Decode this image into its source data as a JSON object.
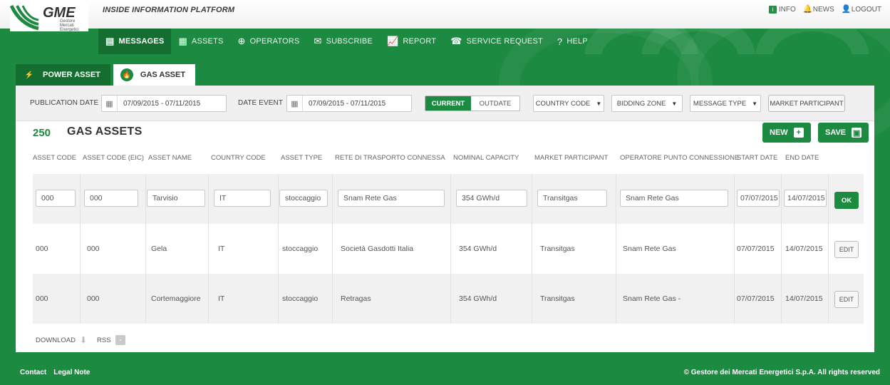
{
  "header": {
    "brand": "GME",
    "brand_sub": [
      "Gestore",
      "Mercati",
      "Energetici"
    ],
    "platform_title": "INSIDE INFORMATION PLATFORM",
    "top_links": [
      {
        "label": "INFO",
        "icon": "info-icon"
      },
      {
        "label": "NEWS",
        "icon": "bell-icon"
      },
      {
        "label": "LOGOUT",
        "icon": "user-icon"
      }
    ]
  },
  "nav": {
    "items": [
      {
        "label": "MESSAGES",
        "icon": "messages-icon",
        "active": true
      },
      {
        "label": "ASSETS",
        "icon": "factory-icon",
        "active": false
      },
      {
        "label": "OPERATORS",
        "icon": "operators-icon",
        "active": false
      },
      {
        "label": "SUBSCRIBE",
        "icon": "envelope-icon",
        "active": false
      },
      {
        "label": "REPORT",
        "icon": "chart-icon",
        "active": false
      },
      {
        "label": "SERVICE REQUEST",
        "icon": "support-icon",
        "active": false
      },
      {
        "label": "HELP",
        "icon": "help-icon",
        "active": false
      }
    ]
  },
  "tabs": [
    {
      "label": "POWER ASSET",
      "icon": "lightning-icon",
      "active": false
    },
    {
      "label": "GAS ASSET",
      "icon": "flame-icon",
      "active": true
    }
  ],
  "filters": {
    "publication_date_label": "PUBLICATION DATE",
    "publication_date_value": "07/09/2015 - 07/11/2015",
    "date_event_label": "DATE EVENT",
    "date_event_value": "07/09/2015 - 07/11/2015",
    "current_label": "CURRENT",
    "outdate_label": "OUTDATE",
    "country_code": "COUNTRY CODE",
    "bidding_zone": "BIDDING ZONE",
    "message_type": "MESSAGE TYPE",
    "market_participant": "MARKET PARTICIPANT"
  },
  "section": {
    "count": "250",
    "title": "GAS ASSETS",
    "new_label": "NEW",
    "save_label": "SAVE"
  },
  "table": {
    "columns": [
      "ASSET CODE",
      "ASSET CODE (EIC)",
      "ASSET NAME",
      "COUNTRY CODE",
      "ASSET TYPE",
      "RETE DI TRASPORTO CONNESSA",
      "NOMINAL CAPACITY",
      "MARKET PARTICIPANT",
      "OPERATORE PUNTO CONNESSIONE",
      "START DATE",
      "END DATE"
    ],
    "edit_row": [
      "000",
      "000",
      "Tarvisio",
      "IT",
      "stoccaggio",
      "Snam Rete Gas",
      "354 GWh/d",
      "Transitgas",
      "Snam Rete Gas",
      "07/07/2015",
      "14/07/2015"
    ],
    "ok_label": "OK",
    "edit_label": "EDIT",
    "rows": [
      [
        "000",
        "000",
        "Gela",
        "IT",
        "stoccaggio",
        "Società Gasdotti Italia",
        "354 GWh/d",
        "Transitgas",
        "Snam Rete Gas",
        "07/07/2015",
        "14/07/2015"
      ],
      [
        "000",
        "000",
        "Cortemaggiore",
        "IT",
        "stoccaggio",
        "Retragas",
        "354 GWh/d",
        "Transitgas",
        "Snam Rete Gas -",
        "07/07/2015",
        "14/07/2015"
      ]
    ]
  },
  "downloads": {
    "download_label": "DOWNLOAD",
    "rss_label": "RSS"
  },
  "footer": {
    "contact": "Contact",
    "legal": "Legal Note",
    "copyright": "© Gestore dei Mercati Energetici S.p.A.  All rights reserved"
  },
  "colors": {
    "brand_green": "#1c8a40",
    "dark_green": "#136e30"
  }
}
